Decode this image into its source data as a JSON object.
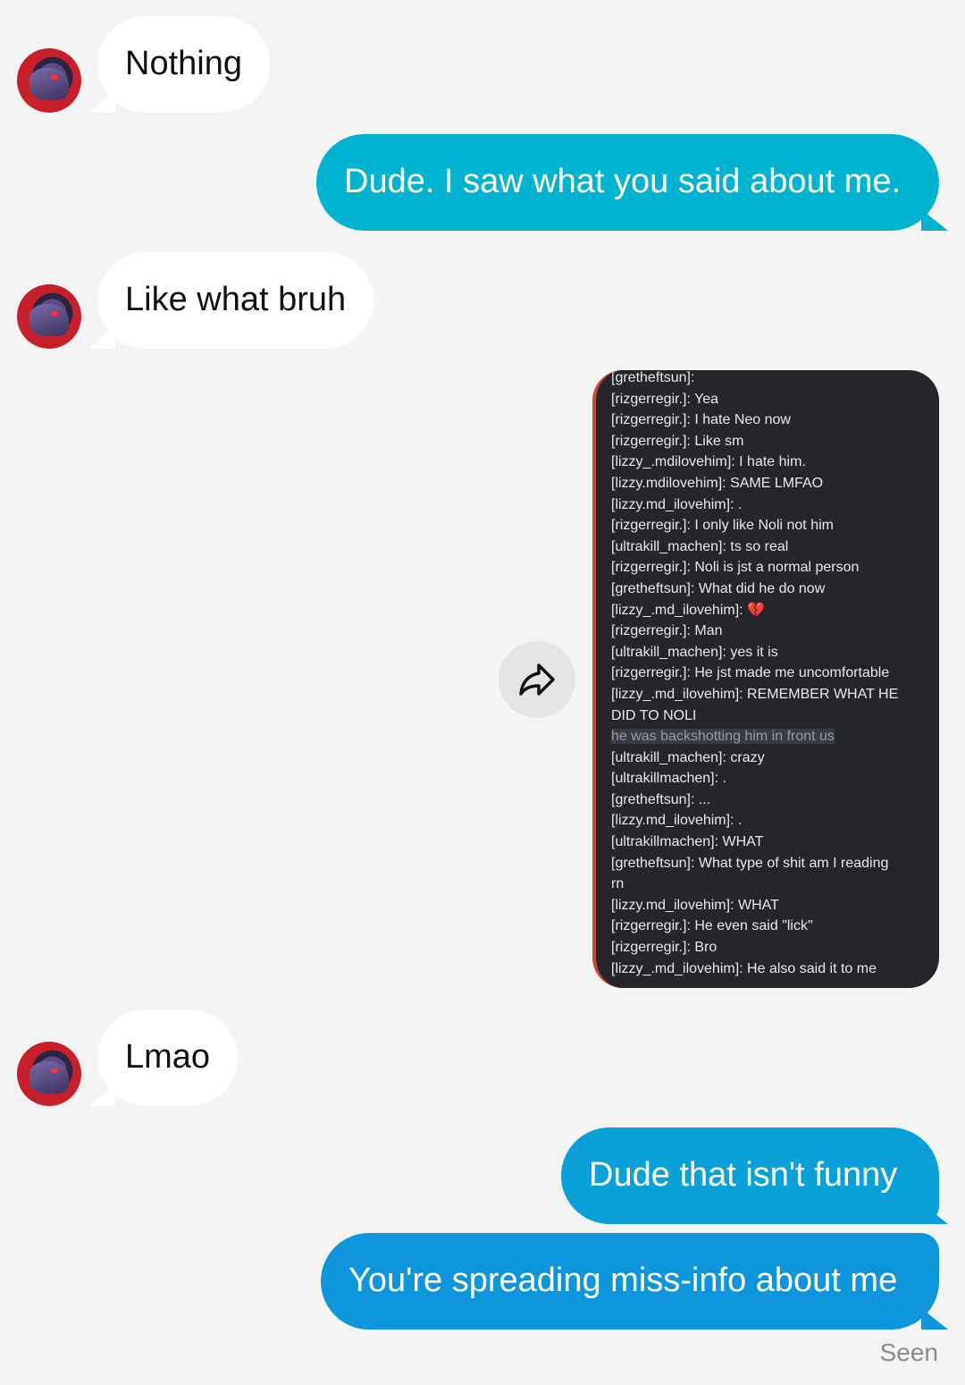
{
  "messages": {
    "m1": "Nothing",
    "m2": "Dude. I saw what you said about me.",
    "m3": "Like what bruh",
    "m4": "Lmao",
    "m5": "Dude that isn't funny",
    "m6": "You're spreading miss-info about me"
  },
  "shared_screenshot": {
    "lines": [
      "[gretheftsun]:",
      "[rizgerregir.]: Yea",
      "[rizgerregir.]: I hate Neo now",
      "[rizgerregir.]: Like sm",
      "[lizzy_.mdilovehim]: I hate him.",
      "[lizzy.mdilovehim]: SAME LMFAO",
      "[lizzy.md_ilovehim]: .",
      "[rizgerregir.]: I only like Noli not him",
      "[ultrakill_machen]: ts so real",
      "[rizgerregir.]: Noli is jst a normal person",
      "[gretheftsun]: What did he do now",
      "[lizzy_.md_ilovehim]: 💔",
      "[rizgerregir.]: Man",
      "[ultrakill_machen]: yes it is",
      "[rizgerregir.]: He jst made me uncomfortable",
      "[lizzy_.md_ilovehim]: REMEMBER WHAT HE",
      "DID TO NOLI",
      "he was backshotting him in front us",
      "[ultrakill_machen]: crazy",
      "[ultrakillmachen]: .",
      "[gretheftsun]: ...",
      "[lizzy.md_ilovehim]: .",
      "[ultrakillmachen]: WHAT",
      "[gretheftsun]: What type of shit am I reading",
      "rn",
      "[lizzy.md_ilovehim]: WHAT",
      "[rizgerregir.]: He even said \"lick\"",
      "[rizgerregir.]: Bro",
      "[lizzy_.md_ilovehim]: He also said it to me"
    ]
  },
  "status": {
    "seen": "Seen"
  },
  "colors": {
    "out_top": "#00b3d1",
    "out_mid": "#0aa0d8",
    "out_bottom": "#0f95dc",
    "in_bg": "#ffffff"
  }
}
